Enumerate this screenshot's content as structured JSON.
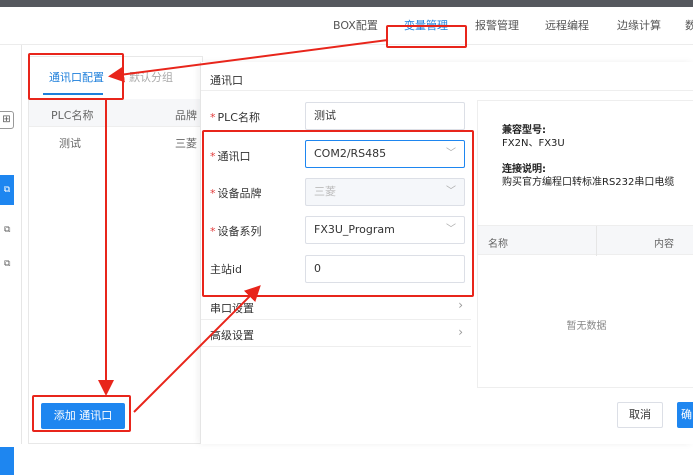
{
  "topnav": {
    "items": [
      {
        "label": "BOX配置",
        "active": false
      },
      {
        "label": "变量管理",
        "active": true
      },
      {
        "label": "报警管理",
        "active": false
      },
      {
        "label": "远程编程",
        "active": false
      },
      {
        "label": "边缘计算",
        "active": false
      },
      {
        "label": "数",
        "active": false
      }
    ]
  },
  "left_strip": {
    "top_icon": "add-box-icon",
    "copy_icon": "copy-icon"
  },
  "port_panel": {
    "tabs": [
      {
        "label": "通讯口配置",
        "active": true
      },
      {
        "label": "默认分组",
        "active": false
      }
    ],
    "columns": [
      "PLC名称",
      "品牌"
    ],
    "rows": [
      {
        "name": "测试",
        "brand": "三菱"
      }
    ],
    "add_button": "添加 通讯口"
  },
  "dialog": {
    "title": "通讯口",
    "fields": {
      "plc_name": {
        "label": "PLC名称",
        "required": true,
        "value": "测试"
      },
      "port": {
        "label": "通讯口",
        "required": true,
        "value": "COM2/RS485"
      },
      "brand": {
        "label": "设备品牌",
        "required": true,
        "value": "三菱"
      },
      "series": {
        "label": "设备系列",
        "required": true,
        "value": "FX3U_Program"
      },
      "station_id": {
        "label": "主站id",
        "required": false,
        "value": "0"
      }
    },
    "sections": [
      {
        "label": "串口设置"
      },
      {
        "label": "高级设置"
      }
    ],
    "info": {
      "compat_label": "兼容型号:",
      "compat_value": "FX2N、FX3U",
      "conn_label": "连接说明:",
      "conn_value": "购买官方编程口转标准RS232串口电缆",
      "table_cols": [
        "名称",
        "内容"
      ],
      "empty_text": "暂无数据"
    },
    "cancel_button": "取消",
    "ok_button": "确"
  },
  "colors": {
    "accent": "#1e86f0",
    "annotation": "#e8251b"
  }
}
